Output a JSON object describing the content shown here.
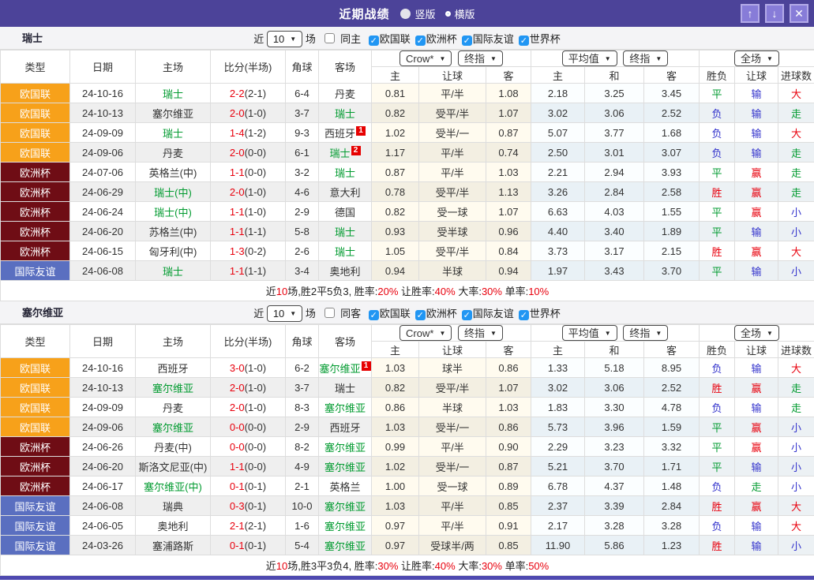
{
  "titlebar": {
    "title": "近期战绩",
    "radios": [
      {
        "label": "竖版",
        "selected": false
      },
      {
        "label": "横版",
        "selected": true
      }
    ],
    "window_buttons": [
      {
        "name": "scroll-up-button",
        "glyph": "↑"
      },
      {
        "name": "scroll-down-button",
        "glyph": "↓"
      },
      {
        "name": "close-button",
        "glyph": "✕"
      }
    ]
  },
  "colors": {
    "header_bg": "#4C4399",
    "button_bg": "#877CD8",
    "orange": "#F7A11A",
    "maroon": "#6F0D15",
    "league_blue": "#5A6FC0",
    "red": "#E8000D",
    "green": "#029B30",
    "blue": "#3333CC",
    "check_accent": "#2196F3"
  },
  "labels": {
    "near": "近",
    "games_count": "10",
    "games": "场",
    "leagues": [
      "欧国联",
      "欧洲杯",
      "国际友谊",
      "世界杯"
    ]
  },
  "dropdowns": {
    "crow": "Crow*",
    "final1": "终指",
    "avg": "平均值",
    "final2": "终指",
    "fulltime": "全场"
  },
  "columns": {
    "main": [
      "类型",
      "日期",
      "主场",
      "比分(半场)",
      "角球",
      "客场"
    ],
    "sub": [
      "主",
      "让球",
      "客",
      "主",
      "和",
      "客",
      "胜负",
      "让球",
      "进球数"
    ]
  },
  "tables": [
    {
      "team": "瑞士",
      "same_label": "同主",
      "same_checked": false,
      "rows": [
        {
          "type": "欧国联",
          "tc": "orange",
          "date": "24-10-16",
          "home": {
            "n": "瑞士",
            "g": true,
            "b": ""
          },
          "score": {
            "ft": "2-2",
            "ht": "(2-1)"
          },
          "corner": "6-4",
          "away": {
            "n": "丹麦",
            "g": false,
            "b": ""
          },
          "crow": [
            "0.81",
            "平/半",
            "1.08"
          ],
          "avg": [
            "2.18",
            "3.25",
            "3.45"
          ],
          "res": [
            [
              "平",
              "g"
            ],
            [
              "输",
              "b"
            ],
            [
              "大",
              "r"
            ]
          ]
        },
        {
          "type": "欧国联",
          "tc": "orange",
          "date": "24-10-13",
          "home": {
            "n": "塞尔维亚",
            "g": false,
            "b": ""
          },
          "score": {
            "ft": "2-0",
            "ht": "(1-0)"
          },
          "corner": "3-7",
          "away": {
            "n": "瑞士",
            "g": true,
            "b": ""
          },
          "crow": [
            "0.82",
            "受平/半",
            "1.07"
          ],
          "avg": [
            "3.02",
            "3.06",
            "2.52"
          ],
          "res": [
            [
              "负",
              "b"
            ],
            [
              "输",
              "b"
            ],
            [
              "走",
              "g"
            ]
          ]
        },
        {
          "type": "欧国联",
          "tc": "orange",
          "date": "24-09-09",
          "home": {
            "n": "瑞士",
            "g": true,
            "b": ""
          },
          "score": {
            "ft": "1-4",
            "ht": "(1-2)"
          },
          "corner": "9-3",
          "away": {
            "n": "西班牙",
            "g": false,
            "b": "1"
          },
          "crow": [
            "1.02",
            "受半/一",
            "0.87"
          ],
          "avg": [
            "5.07",
            "3.77",
            "1.68"
          ],
          "res": [
            [
              "负",
              "b"
            ],
            [
              "输",
              "b"
            ],
            [
              "大",
              "r"
            ]
          ]
        },
        {
          "type": "欧国联",
          "tc": "orange",
          "date": "24-09-06",
          "home": {
            "n": "丹麦",
            "g": false,
            "b": ""
          },
          "score": {
            "ft": "2-0",
            "ht": "(0-0)"
          },
          "corner": "6-1",
          "away": {
            "n": "瑞士",
            "g": true,
            "b": "2"
          },
          "crow": [
            "1.17",
            "平/半",
            "0.74"
          ],
          "avg": [
            "2.50",
            "3.01",
            "3.07"
          ],
          "res": [
            [
              "负",
              "b"
            ],
            [
              "输",
              "b"
            ],
            [
              "走",
              "g"
            ]
          ]
        },
        {
          "type": "欧洲杯",
          "tc": "maroon",
          "date": "24-07-06",
          "home": {
            "n": "英格兰(中)",
            "g": false,
            "b": ""
          },
          "score": {
            "ft": "1-1",
            "ht": "(0-0)"
          },
          "corner": "3-2",
          "away": {
            "n": "瑞士",
            "g": true,
            "b": ""
          },
          "crow": [
            "0.87",
            "平/半",
            "1.03"
          ],
          "avg": [
            "2.21",
            "2.94",
            "3.93"
          ],
          "res": [
            [
              "平",
              "g"
            ],
            [
              "赢",
              "r"
            ],
            [
              "走",
              "g"
            ]
          ]
        },
        {
          "type": "欧洲杯",
          "tc": "maroon",
          "date": "24-06-29",
          "home": {
            "n": "瑞士(中)",
            "g": true,
            "b": ""
          },
          "score": {
            "ft": "2-0",
            "ht": "(1-0)"
          },
          "corner": "4-6",
          "away": {
            "n": "意大利",
            "g": false,
            "b": ""
          },
          "crow": [
            "0.78",
            "受平/半",
            "1.13"
          ],
          "avg": [
            "3.26",
            "2.84",
            "2.58"
          ],
          "res": [
            [
              "胜",
              "r"
            ],
            [
              "赢",
              "r"
            ],
            [
              "走",
              "g"
            ]
          ]
        },
        {
          "type": "欧洲杯",
          "tc": "maroon",
          "date": "24-06-24",
          "home": {
            "n": "瑞士(中)",
            "g": true,
            "b": ""
          },
          "score": {
            "ft": "1-1",
            "ht": "(1-0)"
          },
          "corner": "2-9",
          "away": {
            "n": "德国",
            "g": false,
            "b": ""
          },
          "crow": [
            "0.82",
            "受一球",
            "1.07"
          ],
          "avg": [
            "6.63",
            "4.03",
            "1.55"
          ],
          "res": [
            [
              "平",
              "g"
            ],
            [
              "赢",
              "r"
            ],
            [
              "小",
              "b"
            ]
          ]
        },
        {
          "type": "欧洲杯",
          "tc": "maroon",
          "date": "24-06-20",
          "home": {
            "n": "苏格兰(中)",
            "g": false,
            "b": ""
          },
          "score": {
            "ft": "1-1",
            "ht": "(1-1)"
          },
          "corner": "5-8",
          "away": {
            "n": "瑞士",
            "g": true,
            "b": ""
          },
          "crow": [
            "0.93",
            "受半球",
            "0.96"
          ],
          "avg": [
            "4.40",
            "3.40",
            "1.89"
          ],
          "res": [
            [
              "平",
              "g"
            ],
            [
              "输",
              "b"
            ],
            [
              "小",
              "b"
            ]
          ]
        },
        {
          "type": "欧洲杯",
          "tc": "maroon",
          "date": "24-06-15",
          "home": {
            "n": "匈牙利(中)",
            "g": false,
            "b": ""
          },
          "score": {
            "ft": "1-3",
            "ht": "(0-2)"
          },
          "corner": "2-6",
          "away": {
            "n": "瑞士",
            "g": true,
            "b": ""
          },
          "crow": [
            "1.05",
            "受平/半",
            "0.84"
          ],
          "avg": [
            "3.73",
            "3.17",
            "2.15"
          ],
          "res": [
            [
              "胜",
              "r"
            ],
            [
              "赢",
              "r"
            ],
            [
              "大",
              "r"
            ]
          ]
        },
        {
          "type": "国际友谊",
          "tc": "league_blue",
          "date": "24-06-08",
          "home": {
            "n": "瑞士",
            "g": true,
            "b": ""
          },
          "score": {
            "ft": "1-1",
            "ht": "(1-1)"
          },
          "corner": "3-4",
          "away": {
            "n": "奥地利",
            "g": false,
            "b": ""
          },
          "crow": [
            "0.94",
            "半球",
            "0.94"
          ],
          "avg": [
            "1.97",
            "3.43",
            "3.70"
          ],
          "res": [
            [
              "平",
              "g"
            ],
            [
              "输",
              "b"
            ],
            [
              "小",
              "b"
            ]
          ]
        }
      ],
      "summary": [
        [
          "近",
          false
        ],
        [
          "10",
          true
        ],
        [
          "场,胜2平5负3, 胜率:",
          false
        ],
        [
          "20%",
          true
        ],
        [
          " 让胜率:",
          false
        ],
        [
          "40%",
          true
        ],
        [
          " 大率:",
          false
        ],
        [
          "30%",
          true
        ],
        [
          " 单率:",
          false
        ],
        [
          "10%",
          true
        ]
      ]
    },
    {
      "team": "塞尔维亚",
      "same_label": "同客",
      "same_checked": false,
      "rows": [
        {
          "type": "欧国联",
          "tc": "orange",
          "date": "24-10-16",
          "home": {
            "n": "西班牙",
            "g": false,
            "b": ""
          },
          "score": {
            "ft": "3-0",
            "ht": "(1-0)"
          },
          "corner": "6-2",
          "away": {
            "n": "塞尔维亚",
            "g": true,
            "b": "1"
          },
          "crow": [
            "1.03",
            "球半",
            "0.86"
          ],
          "avg": [
            "1.33",
            "5.18",
            "8.95"
          ],
          "res": [
            [
              "负",
              "b"
            ],
            [
              "输",
              "b"
            ],
            [
              "大",
              "r"
            ]
          ]
        },
        {
          "type": "欧国联",
          "tc": "orange",
          "date": "24-10-13",
          "home": {
            "n": "塞尔维亚",
            "g": true,
            "b": ""
          },
          "score": {
            "ft": "2-0",
            "ht": "(1-0)"
          },
          "corner": "3-7",
          "away": {
            "n": "瑞士",
            "g": false,
            "b": ""
          },
          "crow": [
            "0.82",
            "受平/半",
            "1.07"
          ],
          "avg": [
            "3.02",
            "3.06",
            "2.52"
          ],
          "res": [
            [
              "胜",
              "r"
            ],
            [
              "赢",
              "r"
            ],
            [
              "走",
              "g"
            ]
          ]
        },
        {
          "type": "欧国联",
          "tc": "orange",
          "date": "24-09-09",
          "home": {
            "n": "丹麦",
            "g": false,
            "b": ""
          },
          "score": {
            "ft": "2-0",
            "ht": "(1-0)"
          },
          "corner": "8-3",
          "away": {
            "n": "塞尔维亚",
            "g": true,
            "b": ""
          },
          "crow": [
            "0.86",
            "半球",
            "1.03"
          ],
          "avg": [
            "1.83",
            "3.30",
            "4.78"
          ],
          "res": [
            [
              "负",
              "b"
            ],
            [
              "输",
              "b"
            ],
            [
              "走",
              "g"
            ]
          ]
        },
        {
          "type": "欧国联",
          "tc": "orange",
          "date": "24-09-06",
          "home": {
            "n": "塞尔维亚",
            "g": true,
            "b": ""
          },
          "score": {
            "ft": "0-0",
            "ht": "(0-0)"
          },
          "corner": "2-9",
          "away": {
            "n": "西班牙",
            "g": false,
            "b": ""
          },
          "crow": [
            "1.03",
            "受半/一",
            "0.86"
          ],
          "avg": [
            "5.73",
            "3.96",
            "1.59"
          ],
          "res": [
            [
              "平",
              "g"
            ],
            [
              "赢",
              "r"
            ],
            [
              "小",
              "b"
            ]
          ]
        },
        {
          "type": "欧洲杯",
          "tc": "maroon",
          "date": "24-06-26",
          "home": {
            "n": "丹麦(中)",
            "g": false,
            "b": ""
          },
          "score": {
            "ft": "0-0",
            "ht": "(0-0)"
          },
          "corner": "8-2",
          "away": {
            "n": "塞尔维亚",
            "g": true,
            "b": ""
          },
          "crow": [
            "0.99",
            "平/半",
            "0.90"
          ],
          "avg": [
            "2.29",
            "3.23",
            "3.32"
          ],
          "res": [
            [
              "平",
              "g"
            ],
            [
              "赢",
              "r"
            ],
            [
              "小",
              "b"
            ]
          ]
        },
        {
          "type": "欧洲杯",
          "tc": "maroon",
          "date": "24-06-20",
          "home": {
            "n": "斯洛文尼亚(中)",
            "g": false,
            "b": ""
          },
          "score": {
            "ft": "1-1",
            "ht": "(0-0)"
          },
          "corner": "4-9",
          "away": {
            "n": "塞尔维亚",
            "g": true,
            "b": ""
          },
          "crow": [
            "1.02",
            "受半/一",
            "0.87"
          ],
          "avg": [
            "5.21",
            "3.70",
            "1.71"
          ],
          "res": [
            [
              "平",
              "g"
            ],
            [
              "输",
              "b"
            ],
            [
              "小",
              "b"
            ]
          ]
        },
        {
          "type": "欧洲杯",
          "tc": "maroon",
          "date": "24-06-17",
          "home": {
            "n": "塞尔维亚(中)",
            "g": true,
            "b": ""
          },
          "score": {
            "ft": "0-1",
            "ht": "(0-1)"
          },
          "corner": "2-1",
          "away": {
            "n": "英格兰",
            "g": false,
            "b": ""
          },
          "crow": [
            "1.00",
            "受一球",
            "0.89"
          ],
          "avg": [
            "6.78",
            "4.37",
            "1.48"
          ],
          "res": [
            [
              "负",
              "b"
            ],
            [
              "走",
              "g"
            ],
            [
              "小",
              "b"
            ]
          ]
        },
        {
          "type": "国际友谊",
          "tc": "league_blue",
          "date": "24-06-08",
          "home": {
            "n": "瑞典",
            "g": false,
            "b": ""
          },
          "score": {
            "ft": "0-3",
            "ht": "(0-1)"
          },
          "corner": "10-0",
          "away": {
            "n": "塞尔维亚",
            "g": true,
            "b": ""
          },
          "crow": [
            "1.03",
            "平/半",
            "0.85"
          ],
          "avg": [
            "2.37",
            "3.39",
            "2.84"
          ],
          "res": [
            [
              "胜",
              "r"
            ],
            [
              "赢",
              "r"
            ],
            [
              "大",
              "r"
            ]
          ]
        },
        {
          "type": "国际友谊",
          "tc": "league_blue",
          "date": "24-06-05",
          "home": {
            "n": "奥地利",
            "g": false,
            "b": ""
          },
          "score": {
            "ft": "2-1",
            "ht": "(2-1)"
          },
          "corner": "1-6",
          "away": {
            "n": "塞尔维亚",
            "g": true,
            "b": ""
          },
          "crow": [
            "0.97",
            "平/半",
            "0.91"
          ],
          "avg": [
            "2.17",
            "3.28",
            "3.28"
          ],
          "res": [
            [
              "负",
              "b"
            ],
            [
              "输",
              "b"
            ],
            [
              "大",
              "r"
            ]
          ]
        },
        {
          "type": "国际友谊",
          "tc": "league_blue",
          "date": "24-03-26",
          "home": {
            "n": "塞浦路斯",
            "g": false,
            "b": ""
          },
          "score": {
            "ft": "0-1",
            "ht": "(0-1)"
          },
          "corner": "5-4",
          "away": {
            "n": "塞尔维亚",
            "g": true,
            "b": ""
          },
          "crow": [
            "0.97",
            "受球半/两",
            "0.85"
          ],
          "avg": [
            "11.90",
            "5.86",
            "1.23"
          ],
          "res": [
            [
              "胜",
              "r"
            ],
            [
              "输",
              "b"
            ],
            [
              "小",
              "b"
            ]
          ]
        }
      ],
      "summary": [
        [
          "近",
          false
        ],
        [
          "10",
          true
        ],
        [
          "场,胜3平3负4, 胜率:",
          false
        ],
        [
          "30%",
          true
        ],
        [
          " 让胜率:",
          false
        ],
        [
          "40%",
          true
        ],
        [
          " 大率:",
          false
        ],
        [
          "30%",
          true
        ],
        [
          " 单率:",
          false
        ],
        [
          "50%",
          true
        ]
      ]
    }
  ]
}
